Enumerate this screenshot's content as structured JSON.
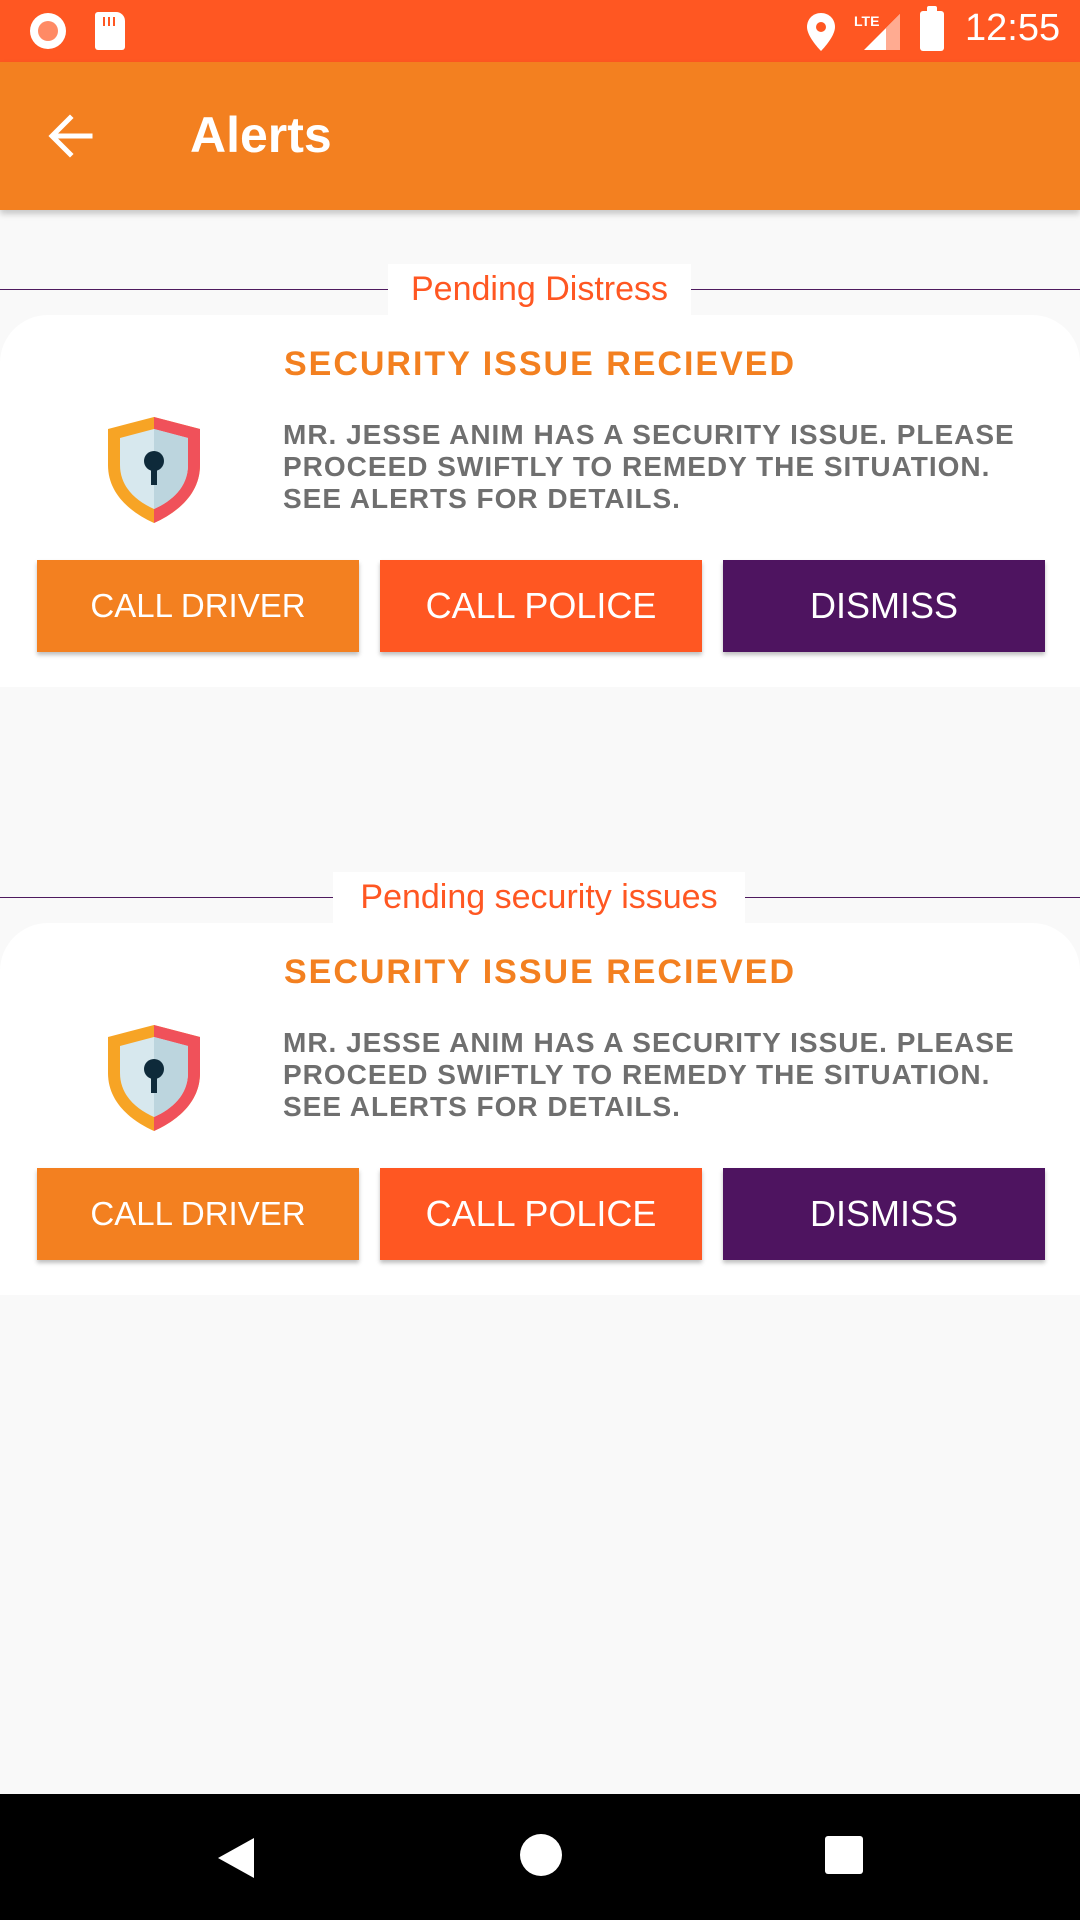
{
  "status_bar": {
    "time": "12:55",
    "network": "LTE"
  },
  "app_bar": {
    "title": "Alerts",
    "back_icon": "arrow-back-icon"
  },
  "sections": [
    {
      "label": "Pending Distress",
      "card": {
        "title": "Security Issue Recieved",
        "icon": "shield-lock-icon",
        "message": "Mr. Jesse Anim has a security issue. Please proceed swiftly to remedy the situation. See alerts for details.",
        "buttons": {
          "call_driver": "CALL DRIVER",
          "call_police": "CALL POLICE",
          "dismiss": "DISMISS"
        }
      }
    },
    {
      "label": "Pending security issues",
      "card": {
        "title": "Security Issue Recieved",
        "icon": "shield-lock-icon",
        "message": "Mr. Jesse Anim has a security issue. Please proceed swiftly to remedy the situation. See alerts for details.",
        "buttons": {
          "call_driver": "CALL DRIVER",
          "call_police": "CALL POLICE",
          "dismiss": "DISMISS"
        }
      }
    }
  ],
  "colors": {
    "status_bar": "#ff5722",
    "app_bar": "#f38020",
    "accent_red": "#ff5722",
    "accent_purple": "#4e1460"
  }
}
